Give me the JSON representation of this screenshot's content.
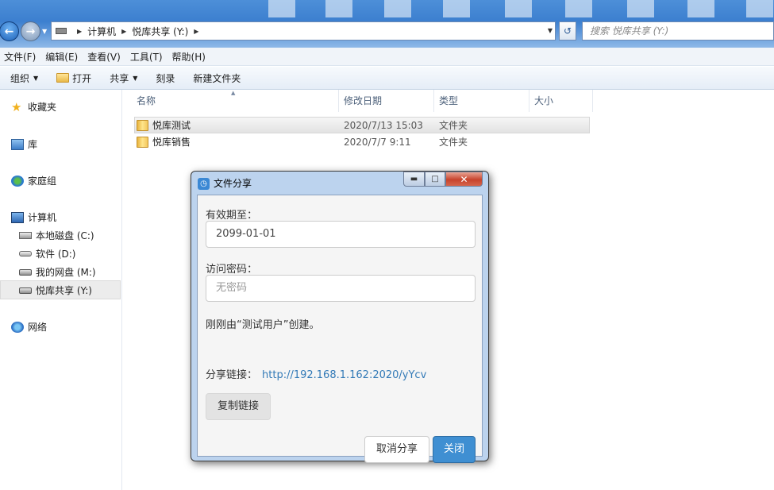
{
  "address": {
    "crumbs": [
      "计算机",
      "悦库共享 (Y:)"
    ],
    "search_placeholder": "搜索 悦库共享 (Y:)"
  },
  "menu": [
    "文件(F)",
    "编辑(E)",
    "查看(V)",
    "工具(T)",
    "帮助(H)"
  ],
  "toolbar": {
    "organize": "组织",
    "open": "打开",
    "share": "共享",
    "burn": "刻录",
    "new_folder": "新建文件夹"
  },
  "sidebar": {
    "favorites": "收藏夹",
    "libraries": "库",
    "homegroup": "家庭组",
    "computer": "计算机",
    "drive_c": "本地磁盘 (C:)",
    "drive_d": "软件 (D:)",
    "drive_m": "我的网盘 (M:)",
    "drive_y": "悦库共享 (Y:)",
    "network": "网络"
  },
  "columns": {
    "name": "名称",
    "modified": "修改日期",
    "type": "类型",
    "size": "大小"
  },
  "files": [
    {
      "name": "悦库测试",
      "modified": "2020/7/13 15:03",
      "type": "文件夹"
    },
    {
      "name": "悦库销售",
      "modified": "2020/7/7 9:11",
      "type": "文件夹"
    }
  ],
  "dialog": {
    "title": "文件分享",
    "expiry_label": "有效期至：",
    "expiry_value": "2099-01-01",
    "password_label": "访问密码：",
    "password_placeholder": "无密码",
    "created_note": "刚刚由“测试用户”创建。",
    "link_label": "分享链接：",
    "link_url": "http://192.168.1.162:2020/yYcv",
    "copy_button": "复制链接",
    "cancel_share_button": "取消分享",
    "close_button": "关闭"
  }
}
